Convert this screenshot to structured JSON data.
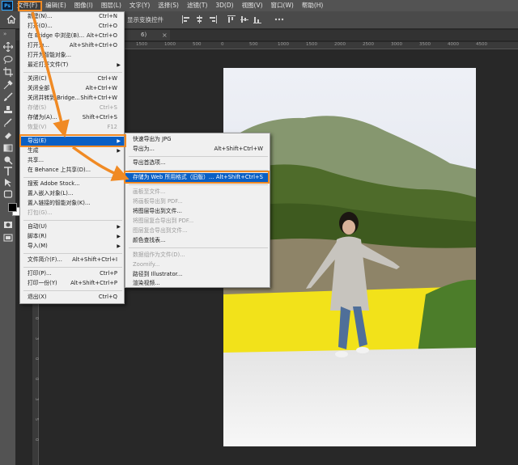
{
  "menubar": {
    "logo": "Ps",
    "items": [
      "文件(F)",
      "编辑(E)",
      "图像(I)",
      "图层(L)",
      "文字(Y)",
      "选择(S)",
      "滤镜(T)",
      "3D(D)",
      "视图(V)",
      "窗口(W)",
      "帮助(H)"
    ]
  },
  "options_bar": {
    "show_transform_controls": "显示变换控件"
  },
  "tab": {
    "fragment": "6)",
    "close": "×"
  },
  "ruler": {
    "top_ticks": [
      "1500",
      "1000",
      "500",
      "0",
      "500",
      "1000",
      "1500",
      "2000",
      "2500",
      "3000",
      "3500",
      "4000",
      "4500"
    ],
    "left_ticks": [
      "1",
      "5",
      "0",
      "0",
      "0",
      "1",
      "5",
      "0",
      "2",
      "0",
      "0",
      "2",
      "5",
      "0",
      "3",
      "0",
      "0",
      "3",
      "5",
      "0"
    ]
  },
  "file_menu": {
    "items": [
      {
        "label": "新建(N)...",
        "shortcut": "Ctrl+N"
      },
      {
        "label": "打开(O)...",
        "shortcut": "Ctrl+O"
      },
      {
        "label": "在 Bridge 中浏览(B)...",
        "shortcut": "Alt+Ctrl+O"
      },
      {
        "label": "打开为...",
        "shortcut": "Alt+Shift+Ctrl+O"
      },
      {
        "label": "打开为智能对象...",
        "shortcut": ""
      },
      {
        "label": "最近打开文件(T)",
        "shortcut": "",
        "submenu": true
      },
      {
        "label": "关闭(C)",
        "shortcut": "Ctrl+W"
      },
      {
        "label": "关闭全部",
        "shortcut": "Alt+Ctrl+W"
      },
      {
        "label": "关闭并转到 Bridge...",
        "shortcut": "Shift+Ctrl+W"
      },
      {
        "label": "存储(S)",
        "shortcut": "Ctrl+S",
        "disabled": true
      },
      {
        "label": "存储为(A)...",
        "shortcut": "Shift+Ctrl+S"
      },
      {
        "label": "恢复(V)",
        "shortcut": "F12",
        "disabled": true
      },
      {
        "label": "导出(E)",
        "shortcut": "",
        "submenu": true,
        "highlighted": true
      },
      {
        "label": "生成",
        "shortcut": "",
        "submenu": true
      },
      {
        "label": "共享...",
        "shortcut": ""
      },
      {
        "label": "在 Behance 上共享(D)...",
        "shortcut": ""
      },
      {
        "label": "搜索 Adobe Stock...",
        "shortcut": ""
      },
      {
        "label": "置入嵌入对象(L)...",
        "shortcut": ""
      },
      {
        "label": "置入链接的智能对象(K)...",
        "shortcut": ""
      },
      {
        "label": "打包(G)...",
        "shortcut": "",
        "disabled": true
      },
      {
        "label": "自动(U)",
        "shortcut": "",
        "submenu": true
      },
      {
        "label": "脚本(R)",
        "shortcut": "",
        "submenu": true
      },
      {
        "label": "导入(M)",
        "shortcut": "",
        "submenu": true
      },
      {
        "label": "文件简介(F)...",
        "shortcut": "Alt+Shift+Ctrl+I"
      },
      {
        "label": "打印(P)...",
        "shortcut": "Ctrl+P"
      },
      {
        "label": "打印一份(Y)",
        "shortcut": "Alt+Shift+Ctrl+P"
      },
      {
        "label": "退出(X)",
        "shortcut": "Ctrl+Q"
      }
    ]
  },
  "export_menu": {
    "items": [
      {
        "label": "快速导出为 JPG",
        "shortcut": ""
      },
      {
        "label": "导出为...",
        "shortcut": "Alt+Shift+Ctrl+W"
      },
      {
        "label": "导出首选项...",
        "shortcut": ""
      },
      {
        "label": "存储为 Web 所用格式（旧版）...",
        "shortcut": "Alt+Shift+Ctrl+S",
        "highlighted": true
      },
      {
        "label": "画板至文件...",
        "shortcut": "",
        "disabled": true
      },
      {
        "label": "将画板导出到 PDF...",
        "shortcut": "",
        "disabled": true
      },
      {
        "label": "将图层导出到文件...",
        "shortcut": ""
      },
      {
        "label": "将图层复合导出到 PDF...",
        "shortcut": "",
        "disabled": true
      },
      {
        "label": "图层复合导出到文件...",
        "shortcut": "",
        "disabled": true
      },
      {
        "label": "颜色查找表...",
        "shortcut": ""
      },
      {
        "label": "数据组作为文件(D)...",
        "shortcut": "",
        "disabled": true
      },
      {
        "label": "Zoomify...",
        "shortcut": "",
        "disabled": true
      },
      {
        "label": "路径到 Illustrator...",
        "shortcut": ""
      },
      {
        "label": "渲染视频...",
        "shortcut": ""
      }
    ]
  },
  "colors": {
    "highlight": "#0a5fc4",
    "annotation": "#f08a24"
  }
}
